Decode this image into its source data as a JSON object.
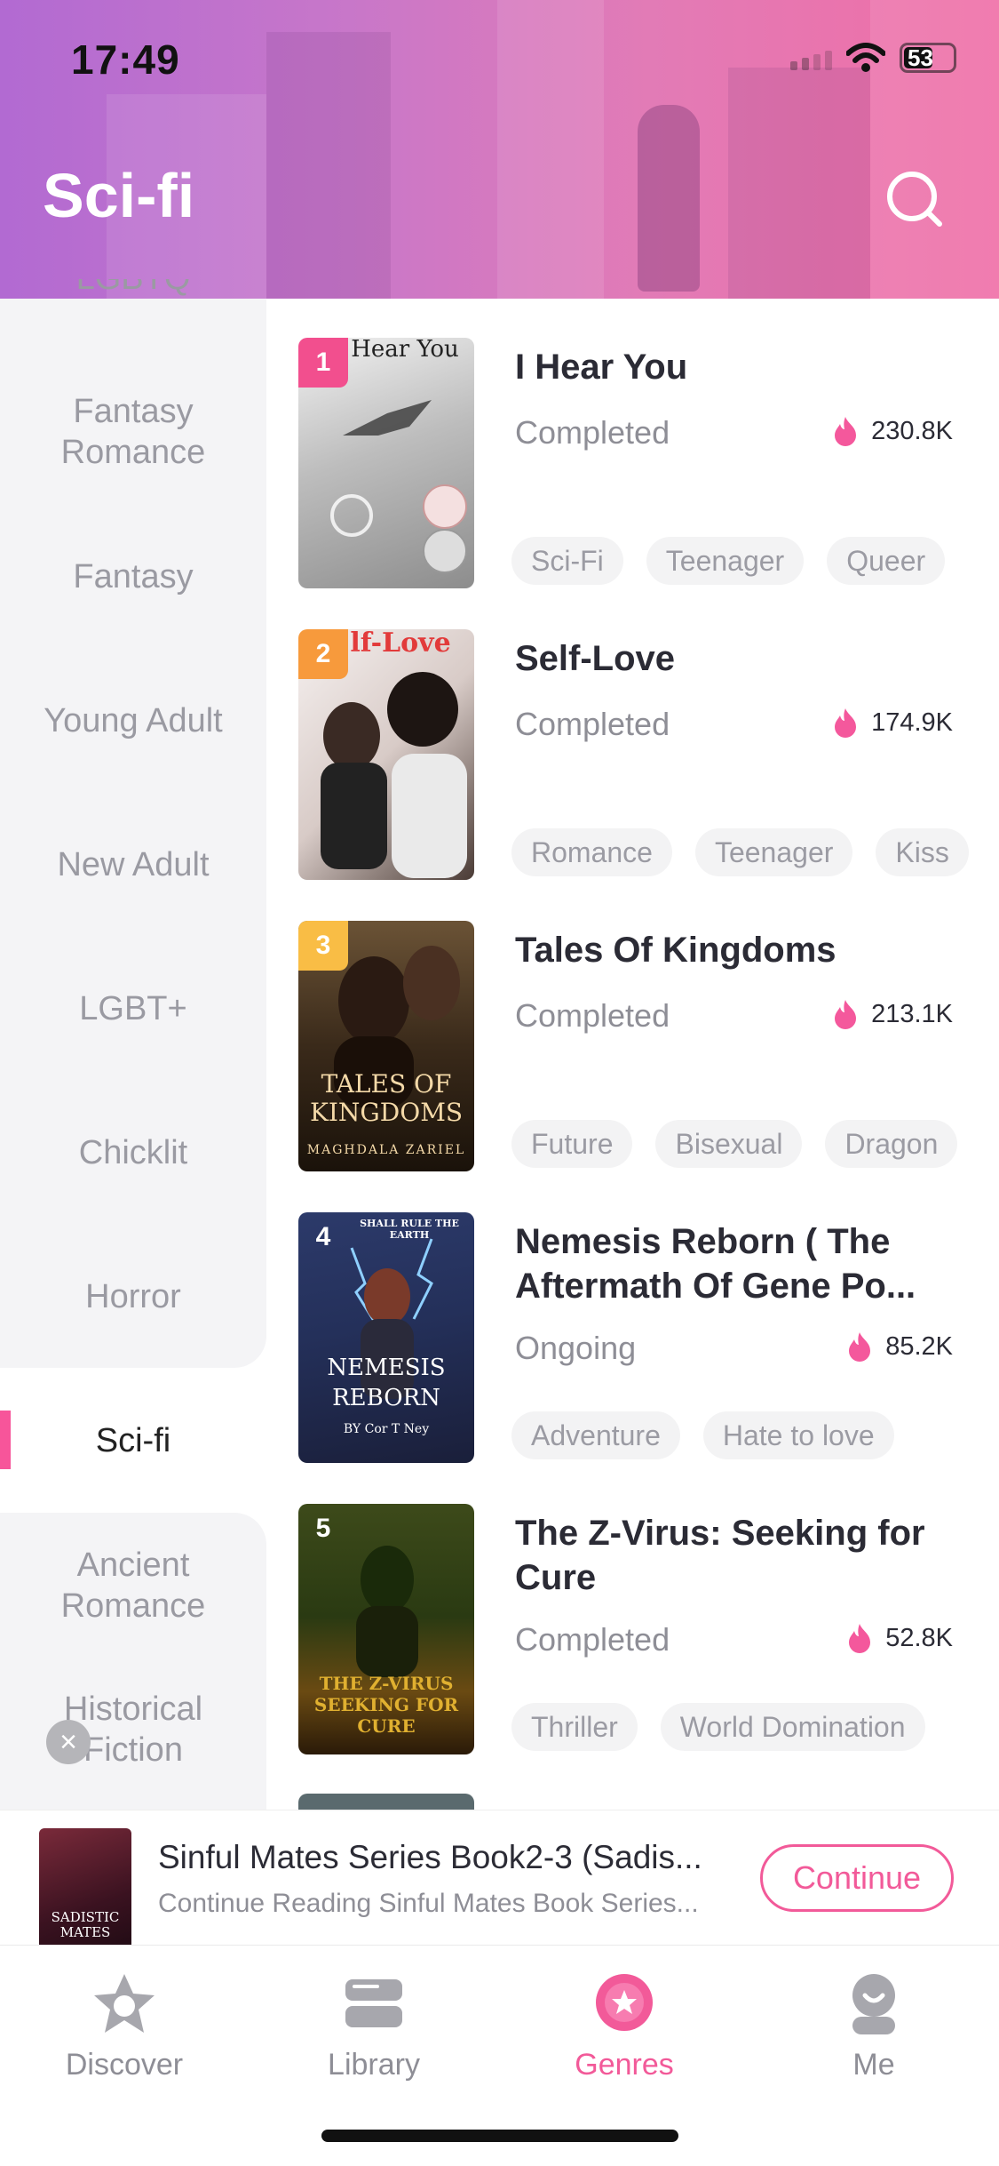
{
  "status_bar": {
    "time": "17:49",
    "battery": "53"
  },
  "header": {
    "title": "Sci-fi"
  },
  "sidebar": {
    "items": [
      {
        "label": "LGBTQ"
      },
      {
        "label": "Fantasy Romance"
      },
      {
        "label": "Fantasy"
      },
      {
        "label": "Young Adult"
      },
      {
        "label": "New Adult"
      },
      {
        "label": "LGBT+"
      },
      {
        "label": "Chicklit"
      },
      {
        "label": "Horror"
      },
      {
        "label": "Sci-fi",
        "active": true
      },
      {
        "label": "Ancient Romance"
      },
      {
        "label": "Historical Fiction"
      }
    ]
  },
  "books": [
    {
      "rank": "1",
      "title": "I Hear You",
      "status": "Completed",
      "count": "230.8K",
      "tags": [
        "Sci-Fi",
        "Teenager",
        "Queer"
      ],
      "cover_text": "Hear You"
    },
    {
      "rank": "2",
      "title": "Self-Love",
      "status": "Completed",
      "count": "174.9K",
      "tags": [
        "Romance",
        "Teenager",
        "Kiss"
      ],
      "cover_text": "lf-Love"
    },
    {
      "rank": "3",
      "title": "Tales Of Kingdoms",
      "status": "Completed",
      "count": "213.1K",
      "tags": [
        "Future",
        "Bisexual",
        "Dragon"
      ],
      "cover_text": "TALES OF KINGDOMS",
      "cover_author": "MAGHDALA ZARIEL"
    },
    {
      "rank": "4",
      "title": "Nemesis Reborn ( The Aftermath Of Gene Po...",
      "status": "Ongoing",
      "count": "85.2K",
      "tags": [
        "Adventure",
        "Hate to love"
      ],
      "cover_text": "NEMESIS REBORN",
      "cover_author": "BY Cor T Ney"
    },
    {
      "rank": "5",
      "title": "The Z-Virus: Seeking for Cure",
      "status": "Completed",
      "count": "52.8K",
      "tags": [
        "Thriller",
        "World Domination"
      ],
      "cover_text": "THE Z-VIRUS SEEKING FOR CURE"
    }
  ],
  "mini_player": {
    "title": "Sinful Mates Series Book2-3 (Sadis...",
    "subtitle": "Continue Reading Sinful Mates Book Series...",
    "button": "Continue",
    "cover_text": "SADISTIC MATES"
  },
  "nav": {
    "items": [
      {
        "label": "Discover",
        "icon": "compass-star-icon"
      },
      {
        "label": "Library",
        "icon": "bookshelf-icon"
      },
      {
        "label": "Genres",
        "icon": "genres-badge-icon",
        "active": true
      },
      {
        "label": "Me",
        "icon": "profile-icon"
      }
    ]
  },
  "colors": {
    "accent": "#f25a99",
    "rank1": "#f24f8e",
    "rank2": "#f79a3c",
    "rank3": "#f9bd45",
    "rank_other": "#2b2b35"
  }
}
